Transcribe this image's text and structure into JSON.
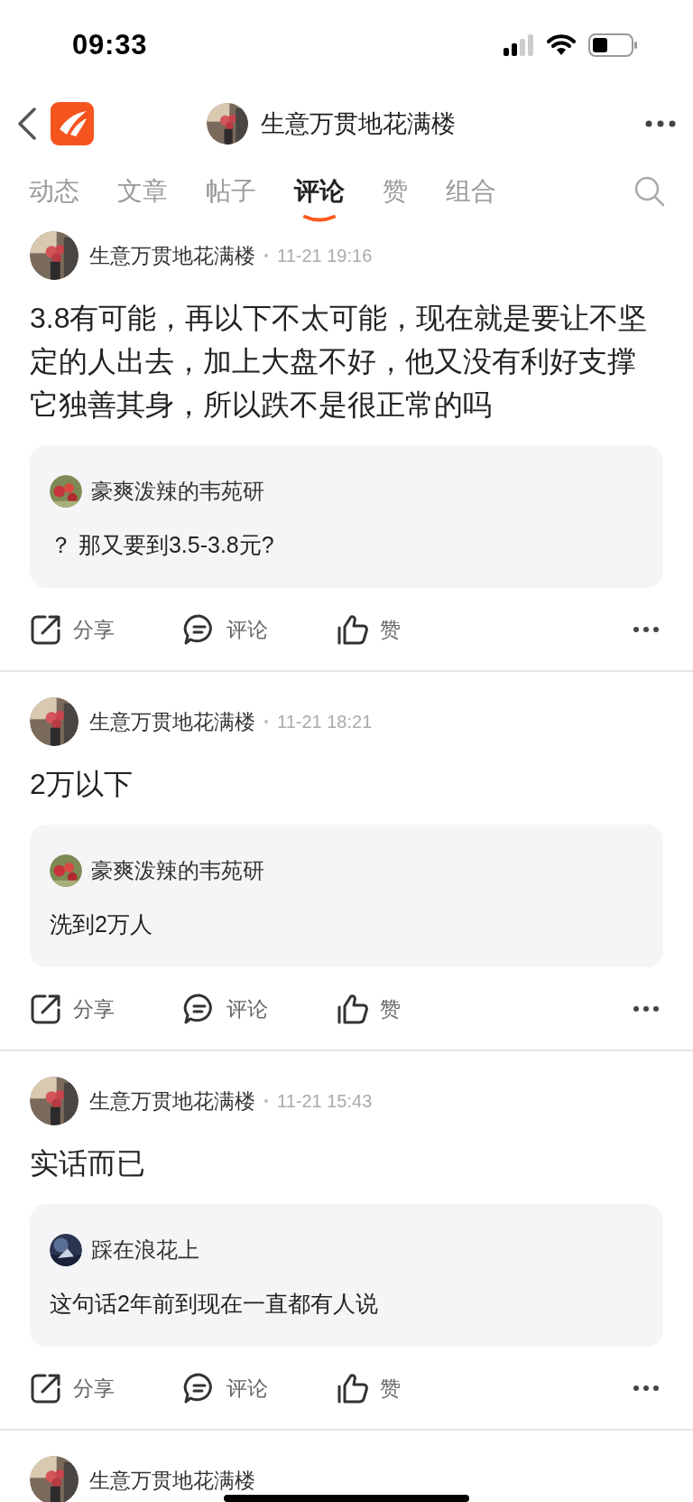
{
  "status_bar": {
    "time": "09:33"
  },
  "header": {
    "title": "生意万贯地花满楼"
  },
  "tabs": [
    {
      "label": "动态",
      "selected": false
    },
    {
      "label": "文章",
      "selected": false
    },
    {
      "label": "帖子",
      "selected": false
    },
    {
      "label": "评论",
      "selected": true
    },
    {
      "label": "赞",
      "selected": false
    },
    {
      "label": "组合",
      "selected": false
    }
  ],
  "posts": [
    {
      "author": "生意万贯地花满楼",
      "time": "11-21 19:16",
      "text": "3.8有可能，再以下不太可能，现在就是要让不坚定的人出去，加上大盘不好，他又没有利好支撑它独善其身，所以跌不是很正常的吗",
      "reply": {
        "author": "豪爽泼辣的韦苑研",
        "text": "？ 那又要到3.5-3.8元?"
      },
      "actions": [
        "分享",
        "评论",
        "赞"
      ]
    },
    {
      "author": "生意万贯地花满楼",
      "time": "11-21 18:21",
      "text": "2万以下",
      "reply": {
        "author": "豪爽泼辣的韦苑研",
        "text": "洗到2万人"
      },
      "actions": [
        "分享",
        "评论",
        "赞"
      ]
    },
    {
      "author": "生意万贯地花满楼",
      "time": "11-21 15:43",
      "text": "实话而已",
      "reply": {
        "author": "踩在浪花上",
        "text": "这句话2年前到现在一直都有人说"
      },
      "actions": [
        "分享",
        "评论",
        "赞"
      ]
    },
    {
      "author": "生意万贯地花满楼"
    }
  ]
}
